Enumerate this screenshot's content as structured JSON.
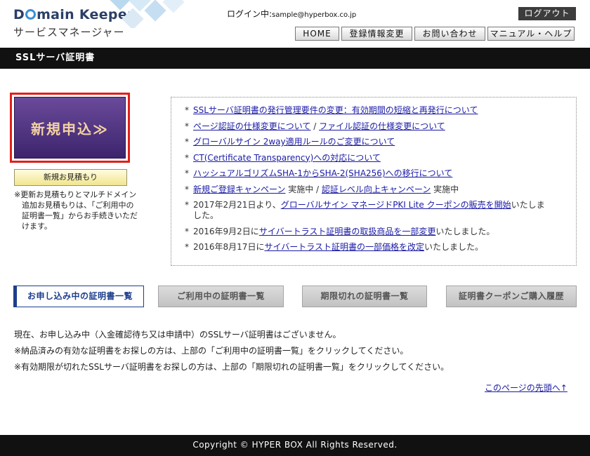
{
  "header": {
    "logo_main_before": "D",
    "logo_main_after": "main Keeper",
    "logo_sub": "サービスマネージャー",
    "login_label": "ログイン中:",
    "login_email": "sample@hyperbox.co.jp",
    "logout_label": "ログアウト",
    "nav": [
      {
        "label": "HOME"
      },
      {
        "label": "登録情報変更"
      },
      {
        "label": "お問い合わせ"
      },
      {
        "label": "マニュアル・ヘルプ"
      }
    ]
  },
  "page_title": "SSLサーバ証明書",
  "apply_button_label": "新規申込≫",
  "estimate_button_label": "新規お見積もり",
  "estimate_note": "※更新お見積もりとマルチドメイン追加お見積もりは、「ご利用中の証明書一覧」からお手続きいただけます。",
  "news": [
    {
      "bullet": "*",
      "link": "SSLサーバ証明書の発行管理要件の変更：有効期間の短縮と再発行について"
    },
    {
      "bullet": "*",
      "link": "ページ認証の仕様変更について",
      "separator": " / ",
      "link2": "ファイル認証の仕様変更について"
    },
    {
      "bullet": "*",
      "link": "グローバルサイン 2way適用ルールのご変更について"
    },
    {
      "bullet": "*",
      "link": "CT(Certificate Transparency)への対応について"
    },
    {
      "bullet": "*",
      "link": "ハッシュアルゴリズムSHA-1からSHA-2(SHA256)への移行について"
    },
    {
      "bullet": "*",
      "link": "新規ご登録キャンペーン",
      "after": " 実施中 / ",
      "link2": "認証レベル向上キャンペーン",
      "after2": " 実施中"
    },
    {
      "bullet": "*",
      "before": "2017年2月21日より、",
      "link": "グローバルサイン マネージドPKI Lite クーポンの販売を開始",
      "after": "いたしました。"
    },
    {
      "bullet": "*",
      "before": "2016年9月2日に",
      "link": "サイバートラスト証明書の取扱商品を一部変更",
      "after": "いたしました。"
    },
    {
      "bullet": "*",
      "before": "2016年8月17日に",
      "link": "サイバートラスト証明書の一部価格を改定",
      "after": "いたしました。"
    }
  ],
  "tabs": [
    {
      "label": "お申し込み中の証明書一覧",
      "active": true
    },
    {
      "label": "ご利用中の証明書一覧",
      "active": false
    },
    {
      "label": "期限切れの証明書一覧",
      "active": false
    },
    {
      "label": "証明書クーポンご購入履歴",
      "active": false
    }
  ],
  "messages": [
    "現在、お申し込み中（入金確認待ち又は申請中）のSSLサーバ証明書はございません。",
    "※納品済みの有効な証明書をお探しの方は、上部の「ご利用中の証明書一覧」をクリックしてください。",
    "※有効期限が切れたSSLサーバ証明書をお探しの方は、上部の「期限切れの証明書一覧」をクリックしてください。"
  ],
  "back_to_top_label": "このページの先頭へ↑",
  "footer_text": "Copyright © HYPER BOX All Rights Reserved.",
  "colors": {
    "title_bar": "#111111",
    "apply_frame": "#e0201a",
    "apply_button": "#4a2d7e",
    "link": "#1a1aa6",
    "active_tab": "#1d3e8c"
  }
}
